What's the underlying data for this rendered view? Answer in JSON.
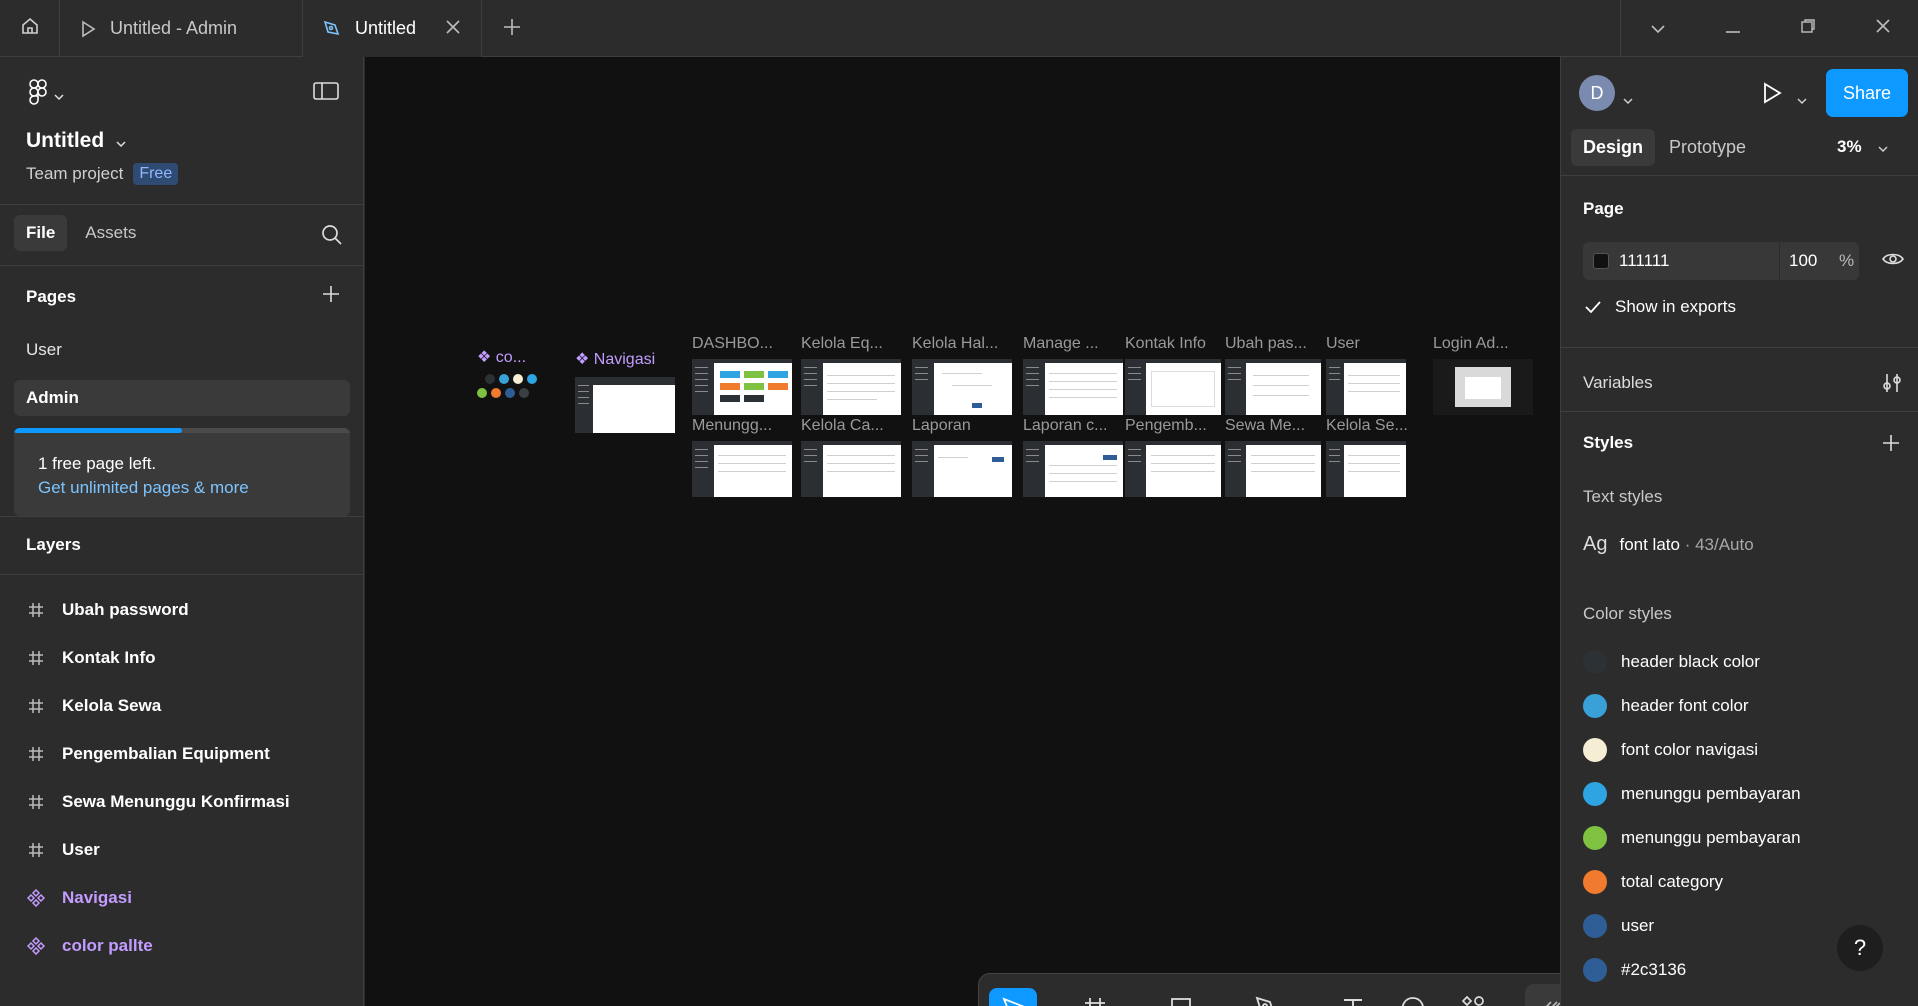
{
  "tabs": [
    {
      "title": "Untitled - Admin"
    },
    {
      "title": "Untitled"
    }
  ],
  "file": {
    "title": "Untitled",
    "team": "Team project",
    "plan_badge": "Free"
  },
  "left_tabs": {
    "file": "File",
    "assets": "Assets"
  },
  "pages": {
    "heading": "Pages",
    "items": [
      {
        "label": "User"
      },
      {
        "label": "Admin"
      }
    ]
  },
  "upsell": {
    "line1": "1 free page left.",
    "line2": "Get unlimited pages & more",
    "progress": 0.5
  },
  "layers": {
    "heading": "Layers",
    "items": [
      {
        "label": "Ubah password",
        "kind": "frame"
      },
      {
        "label": "Kontak Info",
        "kind": "frame"
      },
      {
        "label": "Kelola Sewa",
        "kind": "frame"
      },
      {
        "label": "Pengembalian Equipment",
        "kind": "frame"
      },
      {
        "label": "Sewa Menunggu Konfirmasi",
        "kind": "frame"
      },
      {
        "label": "User",
        "kind": "frame"
      },
      {
        "label": "Navigasi",
        "kind": "component"
      },
      {
        "label": "color pallte",
        "kind": "component"
      }
    ]
  },
  "canvas": {
    "labels": {
      "color": "co...",
      "navigasi": "Navigasi",
      "row1": [
        "DASHBO...",
        "Kelola Eq...",
        "Kelola Hal...",
        "Manage ...",
        "Kontak Info",
        "Ubah pas...",
        "User",
        "Login Ad..."
      ],
      "row2": [
        "Menungg...",
        "Kelola Ca...",
        "Laporan",
        "Laporan c...",
        "Pengemb...",
        "Sewa Me...",
        "Kelola Se..."
      ]
    }
  },
  "toolbar": {
    "tools": [
      "move-tool",
      "frame-tool",
      "shape-tool",
      "pen-tool",
      "text-tool",
      "comment-tool",
      "actions-tool"
    ],
    "modes": [
      "draw-mode",
      "design-mode",
      "dev-mode"
    ]
  },
  "right": {
    "avatar_letter": "D",
    "share": "Share",
    "tabs": {
      "design": "Design",
      "prototype": "Prototype"
    },
    "zoom": "3%",
    "page": {
      "heading": "Page",
      "fill_hex": "111111",
      "opacity": "100",
      "pct": "%",
      "show_exports": "Show in exports"
    },
    "variables": "Variables",
    "styles": {
      "heading": "Styles",
      "text_styles_heading": "Text styles",
      "ag": "Ag",
      "text_style_name": "font lato",
      "text_style_meta": " · 43/Auto",
      "color_styles_heading": "Color styles",
      "colors": [
        {
          "name": "header black color",
          "hex": "#2c3136"
        },
        {
          "name": "header font color",
          "hex": "#3aa0d8"
        },
        {
          "name": "font color navigasi",
          "hex": "#f5edd4"
        },
        {
          "name": "menunggu pembayaran",
          "hex": "#2ea4e3"
        },
        {
          "name": "menunggu pembayaran",
          "hex": "#7fc241"
        },
        {
          "name": "total category",
          "hex": "#f07a2e"
        },
        {
          "name": "user",
          "hex": "#2f5e96"
        },
        {
          "name": "#2c3136",
          "hex": "#2f5e96"
        }
      ]
    },
    "help": "?"
  }
}
